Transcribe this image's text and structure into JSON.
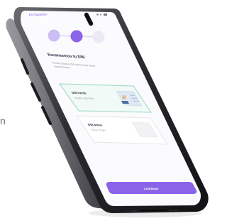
{
  "background_side_text": "n",
  "app": {
    "logo": "cs.hagadoo",
    "brand_color": "#8a63e8",
    "accent_soft": "#cdbdf5"
  },
  "steps": {
    "count": 3,
    "active_index": 2,
    "states": [
      "done",
      "active",
      "inactive"
    ]
  },
  "screen": {
    "title": "Escaneemos tu DNI",
    "subtitle_line1": "Primero sube la foto para tomar estos",
    "subtitle_line2": "componentes."
  },
  "cards": [
    {
      "label": "DNI frente",
      "hint": "Imagen adjuntada",
      "state": "uploaded",
      "border_color": "#a8dcc9"
    },
    {
      "label": "DNI dorso",
      "hint": "Tomar imagen",
      "state": "empty",
      "border_color": "#e6e6ea"
    }
  ],
  "footer": {
    "continue_label": "Continuar"
  },
  "status_bar": {
    "icons": [
      "signal-icon",
      "wifi-icon",
      "battery-icon"
    ]
  }
}
